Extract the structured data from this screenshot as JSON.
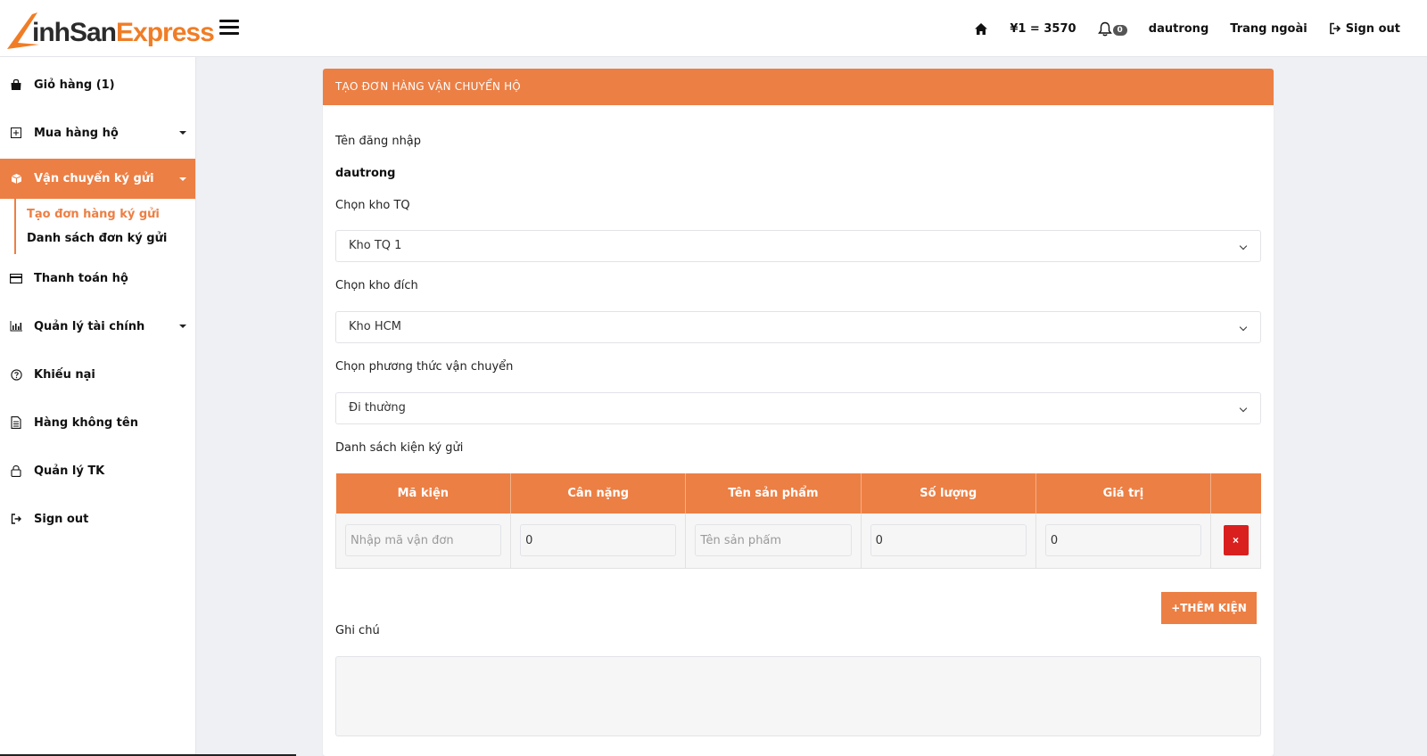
{
  "brand": {
    "logo_letter": "L",
    "logo_text_part": "inhSan",
    "logo_text_accent": "Express",
    "color": "#f07d26"
  },
  "topnav": {
    "rate": "¥1 = 3570",
    "notifications": "0",
    "username": "dautrong",
    "outside": "Trang ngoài",
    "signout": "Sign out"
  },
  "sidebar": {
    "items": [
      {
        "label": "Giỏ hàng (1)",
        "icon": "shopping-bag-icon"
      },
      {
        "label": "Mua hàng hộ",
        "icon": "plus-square-icon"
      },
      {
        "label": "Vận chuyển ký gửi",
        "icon": "box-icon"
      },
      {
        "label": "Thanh toán hộ",
        "icon": "credit-card-icon"
      },
      {
        "label": "Quản lý tài chính",
        "icon": "bar-chart-icon"
      },
      {
        "label": "Khiếu nại",
        "icon": "question-circle-icon"
      },
      {
        "label": "Hàng không tên",
        "icon": "document-icon"
      },
      {
        "label": "Quản lý TK",
        "icon": "lock-icon"
      },
      {
        "label": "Sign out",
        "icon": "sign-out-icon"
      }
    ],
    "sub": [
      {
        "label": "Tạo đơn hàng ký gửi"
      },
      {
        "label": "Danh sách đơn ký gửi"
      }
    ]
  },
  "form": {
    "title": "TẠO ĐƠN HÀNG VẬN CHUYỂN HỘ",
    "username_label": "Tên đăng nhập",
    "username_value": "dautrong",
    "warehouse_cn_label": "Chọn kho TQ",
    "warehouse_cn_value": "Kho TQ 1",
    "warehouse_dest_label": "Chọn kho đích",
    "warehouse_dest_value": "Kho HCM",
    "shipping_label": "Chọn phương thức vận chuyển",
    "shipping_value": "Đi thường",
    "packages_label": "Danh sách kiện ký gửi",
    "columns": [
      "Mã kiện",
      "Cân nặng",
      "Tên sản phẩm",
      "Số lượng",
      "Giá trị"
    ],
    "row": {
      "code_placeholder": "Nhập mã vận đơn",
      "weight": "0",
      "product_placeholder": "Tên sản phẩm",
      "quantity": "0",
      "value": "0"
    },
    "delete_label": "×",
    "add_button": "+THÊM KIỆN",
    "note_label": "Ghi chú"
  }
}
